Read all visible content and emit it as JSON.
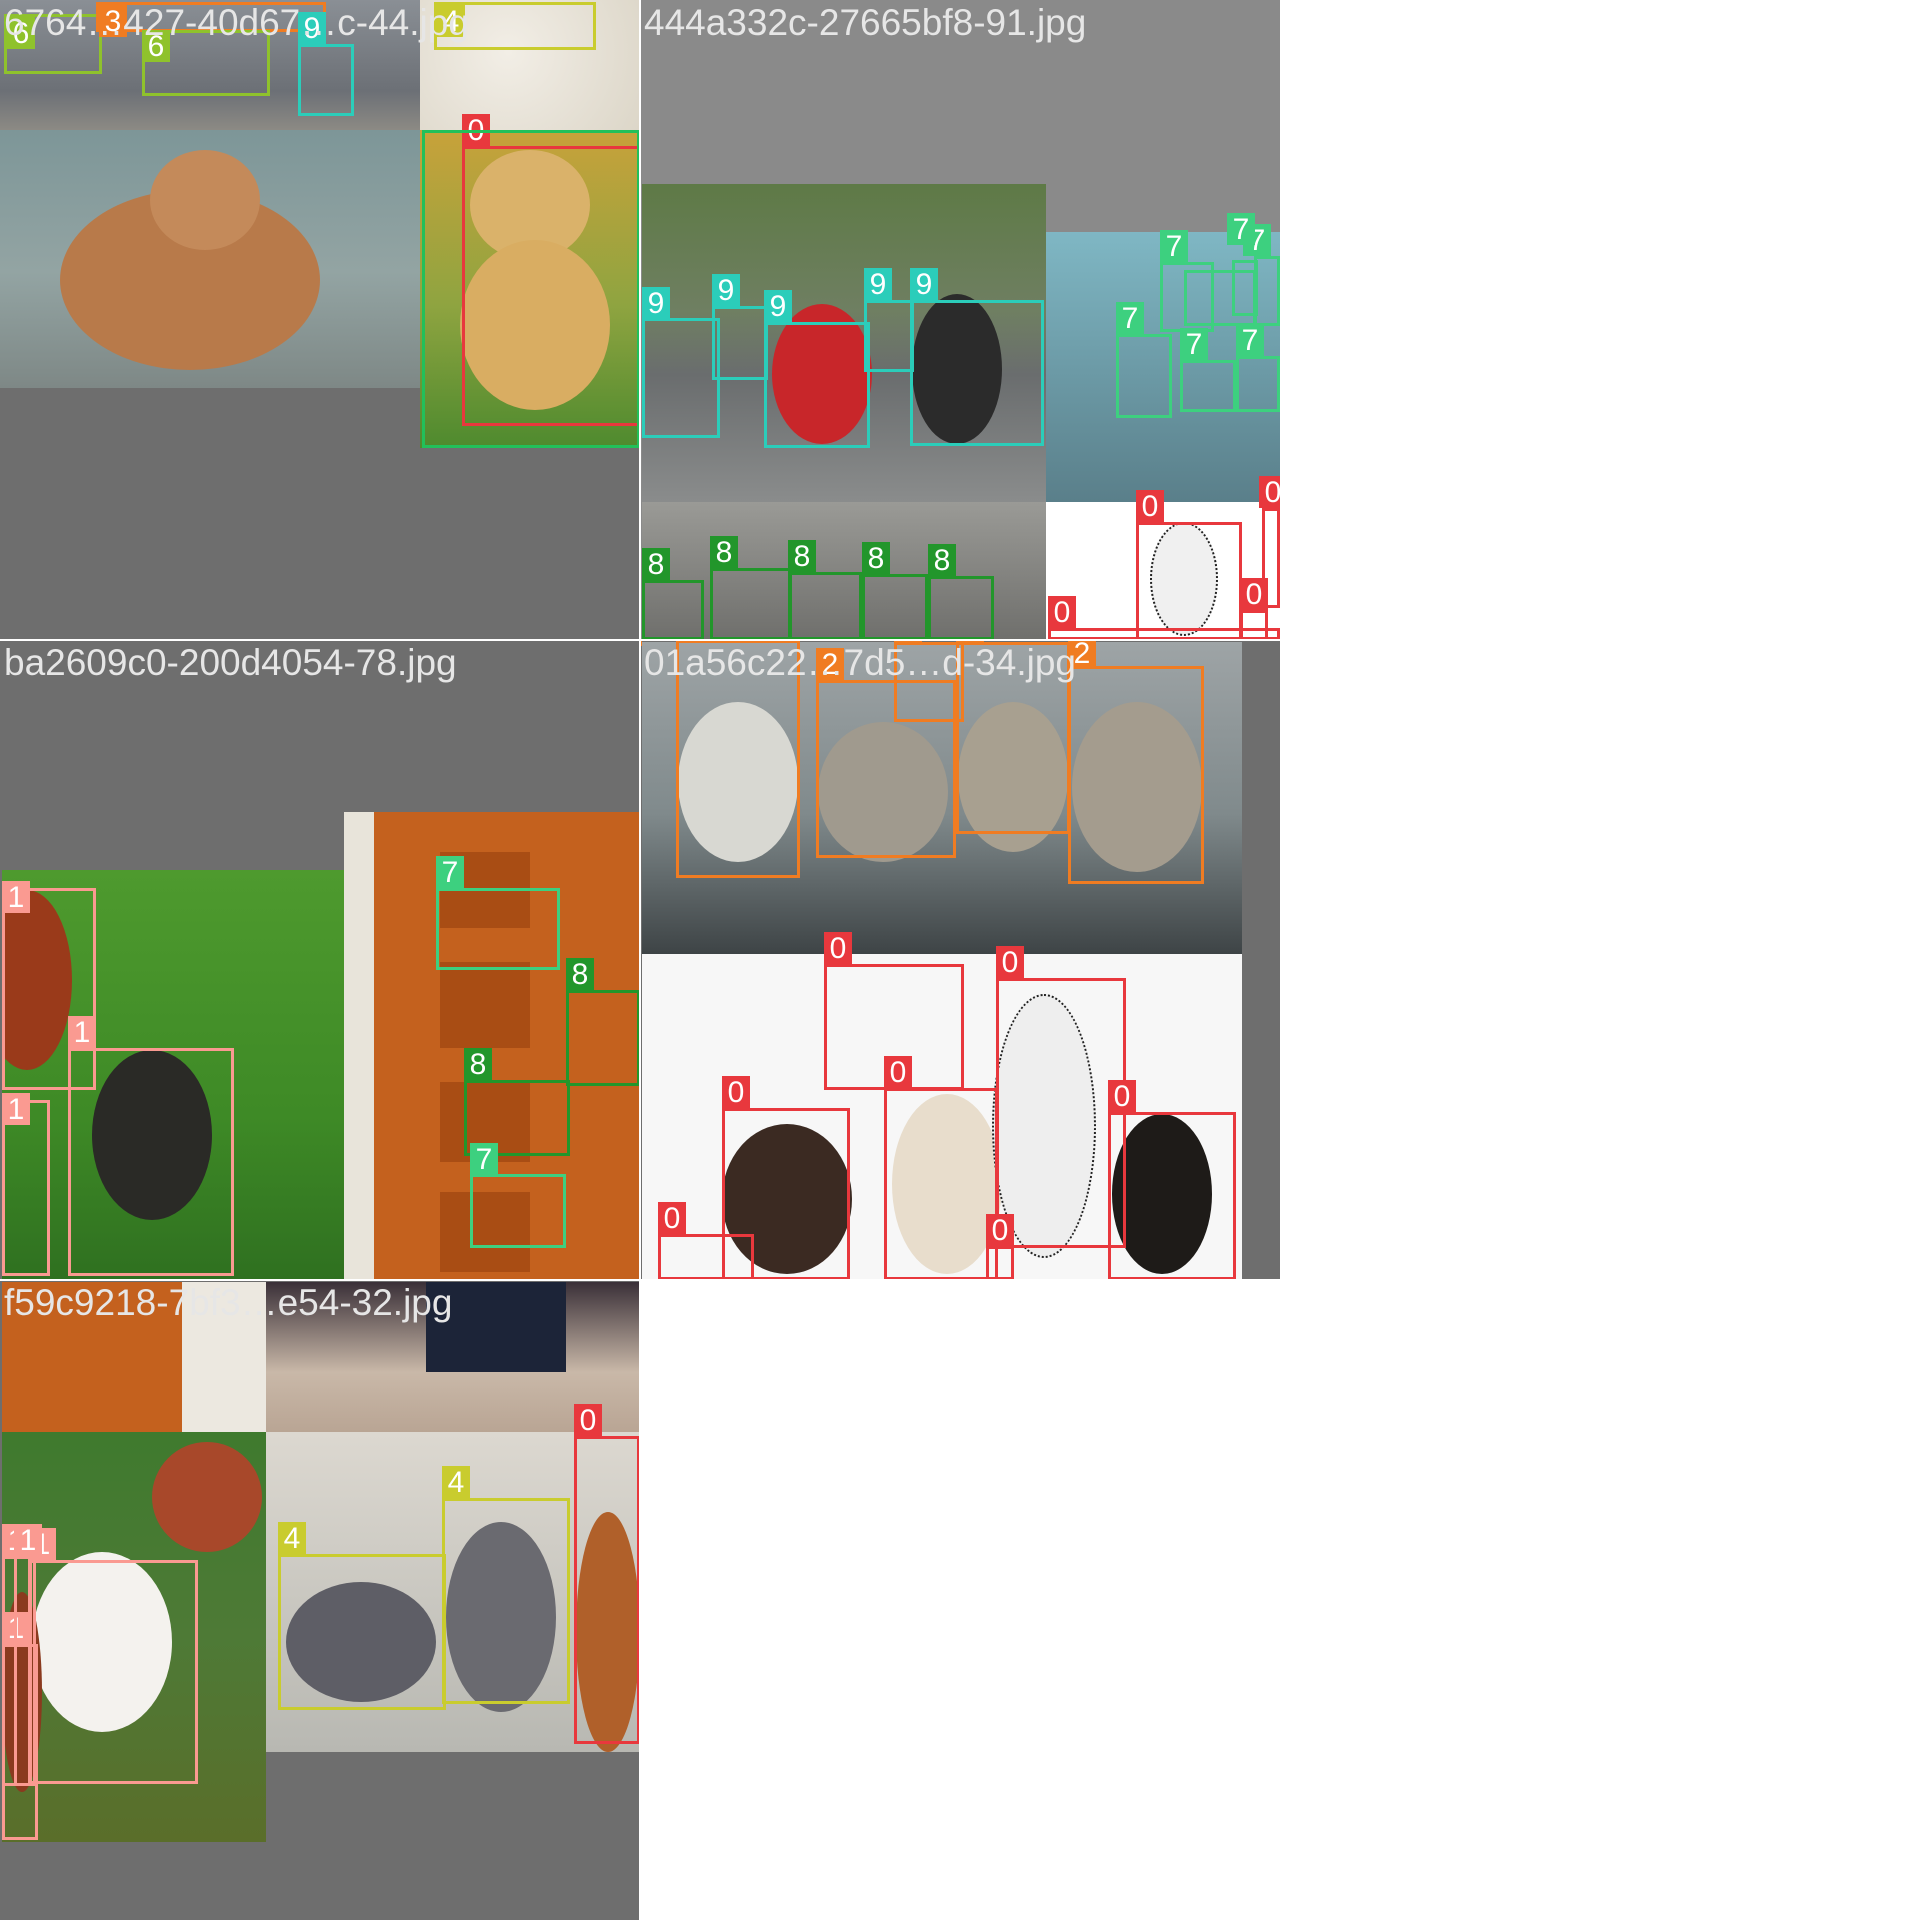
{
  "mosaic_titles": {
    "tile1": "6764…427-40d67…c-44.jpg",
    "tile2": "444a332c-27665bf8-91.jpg",
    "tile3": "ba2609c0-200d4054-78.jpg",
    "tile4": "01a56c22…7d5…d-34.jpg",
    "tile5": "f59c9218-7bf3…e54-32.jpg"
  },
  "class_colors": {
    "0": "#e8383d",
    "1": "#fa9a91",
    "2": "#f07c22",
    "4": "#c9cc2e",
    "6": "#8fc22c",
    "7": "#3dd07f",
    "8": "#22962b",
    "9": "#2bcdba"
  },
  "labels": {
    "t1": [
      "6",
      "3",
      "6",
      "9",
      "4",
      "0"
    ],
    "t2": [
      "9",
      "9",
      "9",
      "9",
      "9",
      "7",
      "7",
      "7",
      "7",
      "7",
      "7",
      "8",
      "8",
      "8",
      "8",
      "8",
      "0",
      "0",
      "0",
      "0"
    ],
    "t3": [
      "1",
      "1",
      "1",
      "7",
      "8",
      "8",
      "7"
    ],
    "t4": [
      "2",
      "2",
      "2",
      "2",
      "2",
      "2",
      "0",
      "0",
      "0",
      "0",
      "0",
      "0",
      "0"
    ],
    "t5": [
      "4",
      "4",
      "0",
      "1",
      "1",
      "1",
      "1"
    ]
  }
}
